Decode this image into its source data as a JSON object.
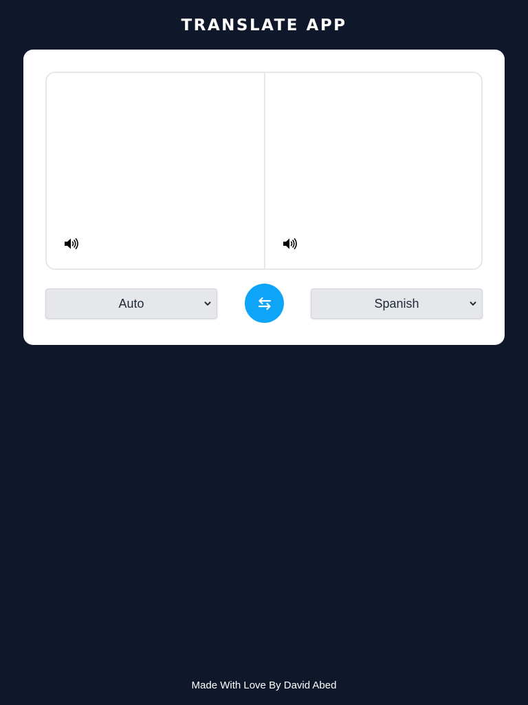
{
  "header": {
    "title": "TRANSLATE APP"
  },
  "translator": {
    "source": {
      "text": "",
      "speak_icon": "volume-icon"
    },
    "target": {
      "text": "",
      "speak_icon": "volume-icon"
    },
    "source_language": {
      "selected": "Auto"
    },
    "target_language": {
      "selected": "Spanish"
    },
    "swap_icon": "exchange-arrows-icon"
  },
  "footer": {
    "credit": "Made With Love By David Abed"
  },
  "colors": {
    "background": "#0f172a",
    "card": "#ffffff",
    "accent": "#0ea5f9",
    "select_bg": "#e5e7eb"
  }
}
